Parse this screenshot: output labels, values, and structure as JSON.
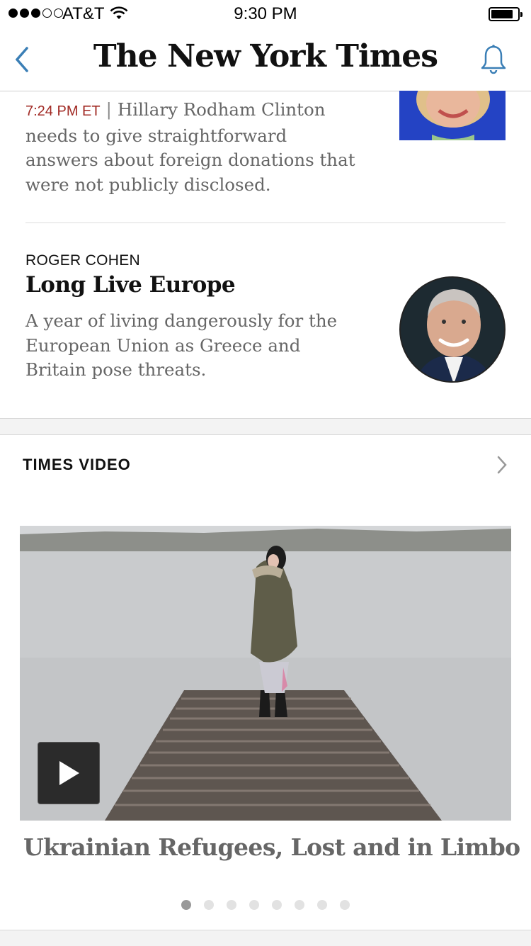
{
  "status_bar": {
    "carrier": "AT&T",
    "time": "9:30 PM",
    "signal_bars_filled": 3,
    "signal_bars_total": 5
  },
  "nav": {
    "logo_text": "The New York Times",
    "back_icon": "chevron-left-icon",
    "alerts_icon": "bell-icon",
    "accent_color": "#3b7fb6"
  },
  "article_1": {
    "timestamp": "7:24 PM ET",
    "separator": "|",
    "summary": "Hillary Rodham Clinton needs to give straightforward answers about foreign donations that were not publicly disclosed.",
    "timestamp_color": "#a12a24"
  },
  "article_2": {
    "byline": "ROGER COHEN",
    "headline": "Long Live Europe",
    "summary": "A year of living dangerously for the European Union as Greece and Britain pose threats."
  },
  "video_section": {
    "title": "TIMES VIDEO",
    "more_icon": "chevron-right-icon",
    "play_icon": "play-icon",
    "caption": "Ukrainian Refugees, Lost and in Limbo",
    "carousel": {
      "total": 8,
      "active_index": 0
    }
  }
}
